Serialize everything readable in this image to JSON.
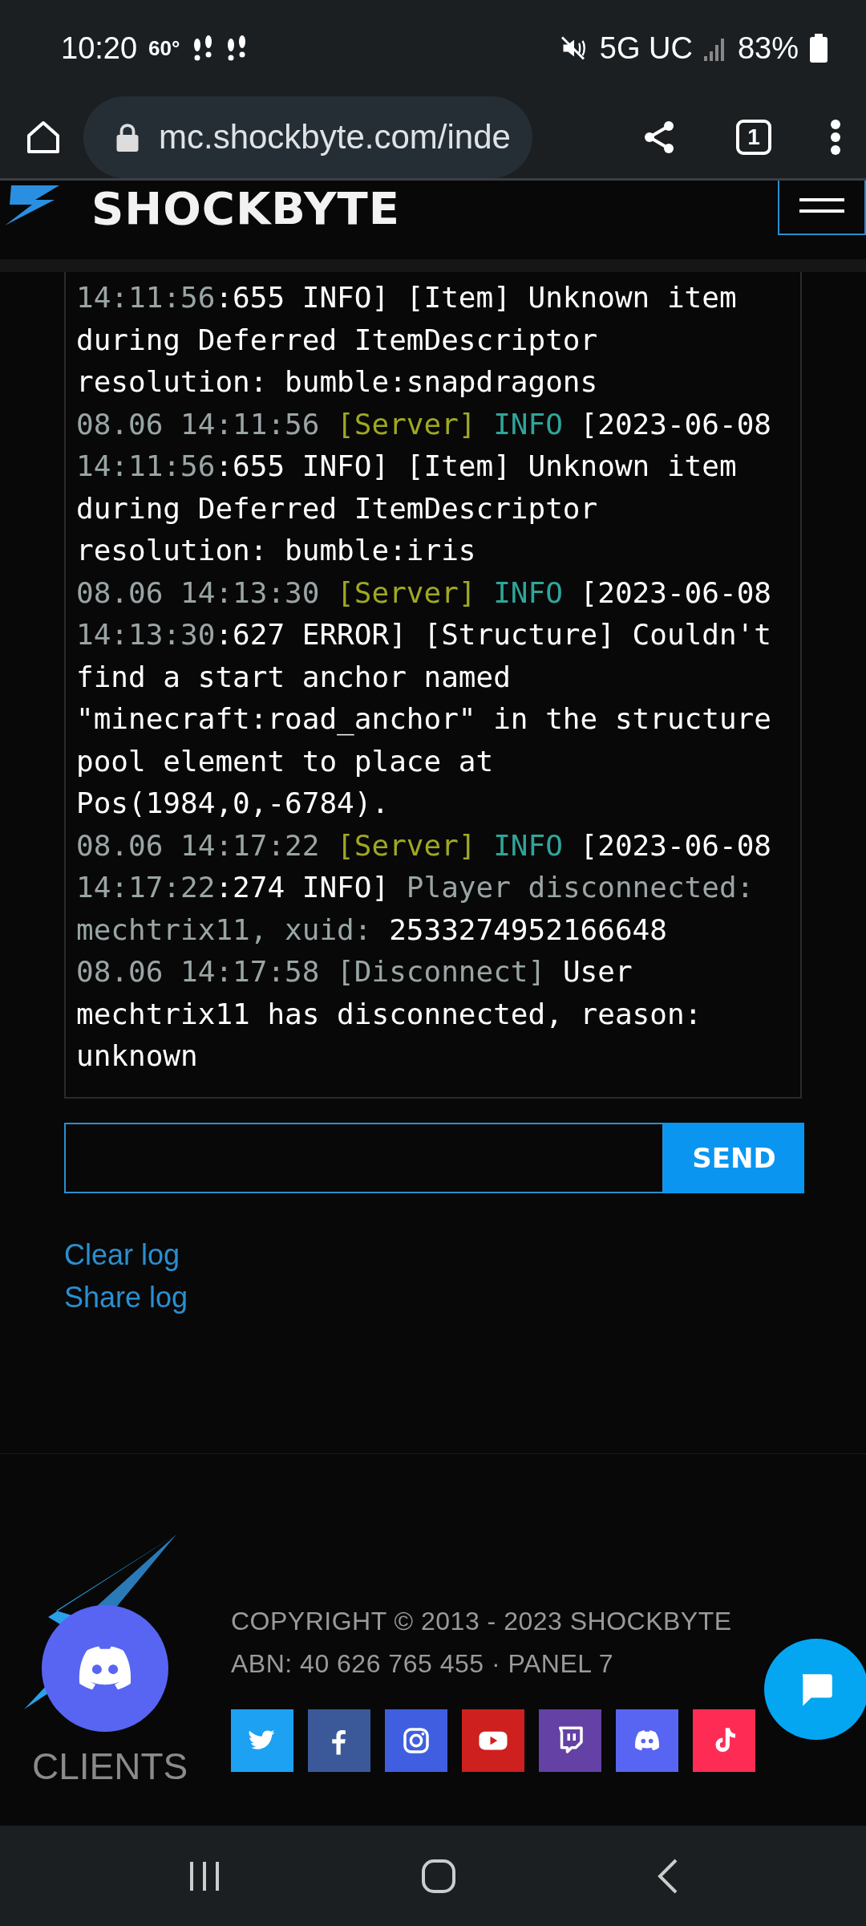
{
  "status_bar": {
    "time": "10:20",
    "temperature": "60°",
    "network": "5G UC",
    "battery": "83%"
  },
  "browser": {
    "url": "mc.shockbyte.com/inde",
    "tab_count": "1"
  },
  "header": {
    "brand": "SHOCKBYTE"
  },
  "console": {
    "lines": [
      [
        {
          "kind": "time",
          "text": "14:11:56"
        },
        {
          "kind": "text",
          "text": ":655 INFO] [Item] Unknown item during Deferred ItemDescriptor resolution: bumble:snapdragons"
        }
      ],
      [
        {
          "kind": "time",
          "text": "08.06 14:11:56 "
        },
        {
          "kind": "source",
          "text": "[Server] "
        },
        {
          "kind": "level",
          "text": "INFO "
        },
        {
          "kind": "text",
          "text": "[2023-06-08 "
        },
        {
          "kind": "time",
          "text": "14:11:56"
        },
        {
          "kind": "text",
          "text": ":655 INFO] [Item] Unknown item during Deferred ItemDescriptor resolution: bumble:iris"
        }
      ],
      [
        {
          "kind": "time",
          "text": "08.06 14:13:30 "
        },
        {
          "kind": "source",
          "text": "[Server] "
        },
        {
          "kind": "level",
          "text": "INFO "
        },
        {
          "kind": "text",
          "text": "[2023-06-08 "
        },
        {
          "kind": "time",
          "text": "14:13:30"
        },
        {
          "kind": "text",
          "text": ":627 ERROR] [Structure] Couldn't find a start anchor named \"minecraft:road_anchor\" in the structure pool element to place at Pos(1984,0,-6784)."
        }
      ],
      [
        {
          "kind": "time",
          "text": "08.06 14:17:22 "
        },
        {
          "kind": "source",
          "text": "[Server] "
        },
        {
          "kind": "level",
          "text": "INFO "
        },
        {
          "kind": "text",
          "text": "[2023-06-08 "
        },
        {
          "kind": "time",
          "text": "14:17:22"
        },
        {
          "kind": "text",
          "text": ":274 INFO] "
        },
        {
          "kind": "muted",
          "text": "Player disconnected: mechtrix11, xuid: "
        },
        {
          "kind": "text",
          "text": "2533274952166648"
        }
      ],
      [
        {
          "kind": "time",
          "text": "08.06 14:17:58 [Disconnect] "
        },
        {
          "kind": "text",
          "text": "User mechtrix11 has disconnected, reason: unknown"
        }
      ]
    ],
    "send_button": "SEND"
  },
  "links": [
    "Clear log",
    "Share log"
  ],
  "footer": {
    "copyright": "COPYRIGHT © 2013 - 2023 SHOCKBYTE",
    "abn": "ABN: 40 626 765 455 · PANEL 7",
    "clients": "CLIENTS",
    "social": [
      {
        "kind": "twitter"
      },
      {
        "kind": "facebook"
      },
      {
        "kind": "instagram"
      },
      {
        "kind": "youtube"
      },
      {
        "kind": "twitch"
      },
      {
        "kind": "discord"
      },
      {
        "kind": "tiktok"
      }
    ]
  }
}
